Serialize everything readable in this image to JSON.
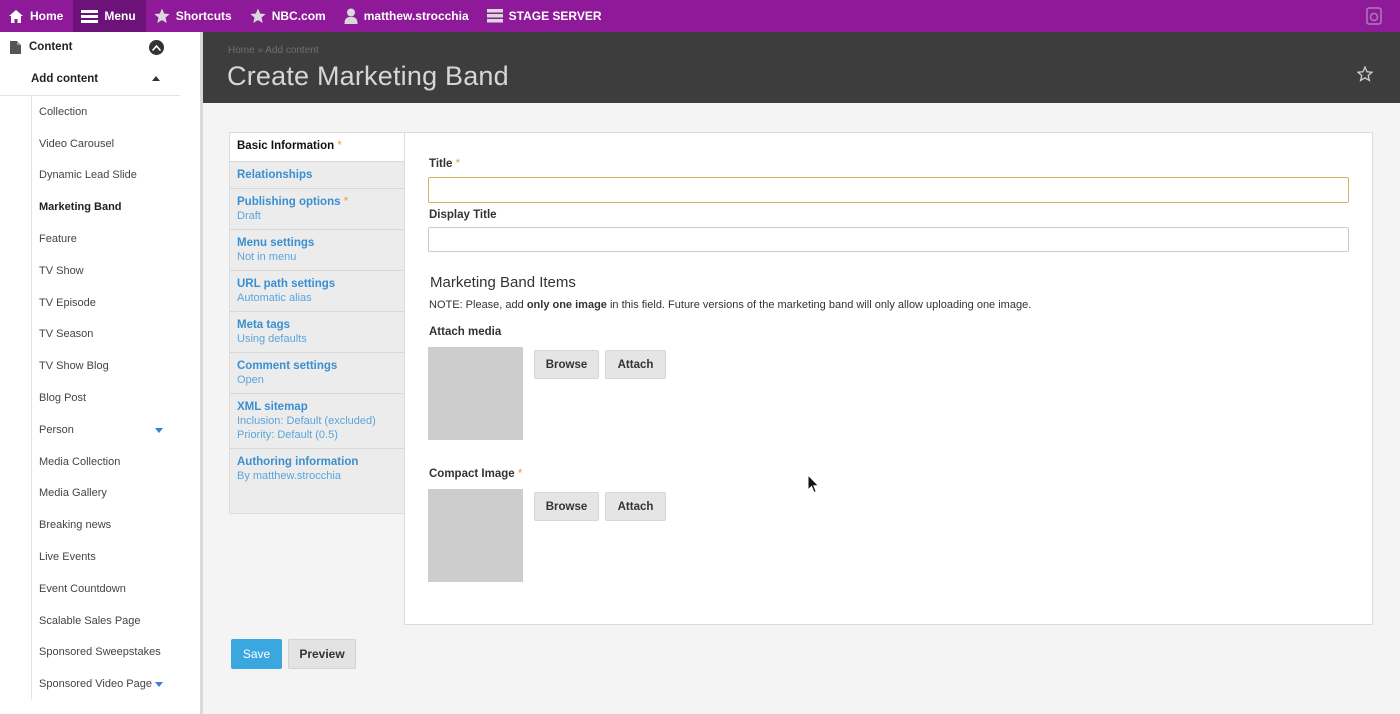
{
  "toolbar": {
    "items": [
      {
        "label": "Home",
        "icon": "home-icon"
      },
      {
        "label": "Menu",
        "icon": "menu-icon"
      },
      {
        "label": "Shortcuts",
        "icon": "star-icon"
      },
      {
        "label": "NBC.com",
        "icon": "star-icon"
      },
      {
        "label": "matthew.strocchia",
        "icon": "user-icon"
      },
      {
        "label": "STAGE SERVER",
        "icon": "server-icon"
      }
    ],
    "colors": {
      "bar": "#8e1a9a",
      "active": "#6c1278"
    }
  },
  "sidebar": {
    "top_label": "Content",
    "add_label": "Add content",
    "items": [
      "Collection",
      "Video Carousel",
      "Dynamic Lead Slide",
      "Marketing Band",
      "Feature",
      "TV Show",
      "TV Episode",
      "TV Season",
      "TV Show Blog",
      "Blog Post",
      "Person",
      "Media Collection",
      "Media Gallery",
      "Breaking news",
      "Live Events",
      "Event Countdown",
      "Scalable Sales Page",
      "Sponsored Sweepstakes",
      "Sponsored Video Page"
    ]
  },
  "header": {
    "breadcrumb": "Home » Add content",
    "title": "Create Marketing Band"
  },
  "vtabs": [
    {
      "title": "Basic Information",
      "summary": "",
      "required": true
    },
    {
      "title": "Relationships",
      "summary": ""
    },
    {
      "title": "Publishing options",
      "summary": "Draft",
      "required": true
    },
    {
      "title": "Menu settings",
      "summary": "Not in menu"
    },
    {
      "title": "URL path settings",
      "summary": "Automatic alias"
    },
    {
      "title": "Meta tags",
      "summary": "Using defaults"
    },
    {
      "title": "Comment settings",
      "summary": "Open"
    },
    {
      "title": "XML sitemap",
      "summary": "Inclusion: Default (excluded)",
      "summary2": "Priority: Default (0.5)"
    },
    {
      "title": "Authoring information",
      "summary": "By matthew.strocchia"
    }
  ],
  "form": {
    "title_label": "Title",
    "title_value": "",
    "display_title_label": "Display Title",
    "display_title_value": "",
    "section_title": "Marketing Band Items",
    "note_prefix": "NOTE: Please, add ",
    "note_bold": "only one image",
    "note_suffix": " in this field. Future versions of the marketing band will only allow uploading one image.",
    "attach_media_label": "Attach media",
    "compact_image_label": "Compact Image",
    "browse_label": "Browse",
    "attach_label": "Attach",
    "required_mark": "*"
  },
  "actions": {
    "save_label": "Save",
    "preview_label": "Preview",
    "save_color": "#3ba7df"
  }
}
